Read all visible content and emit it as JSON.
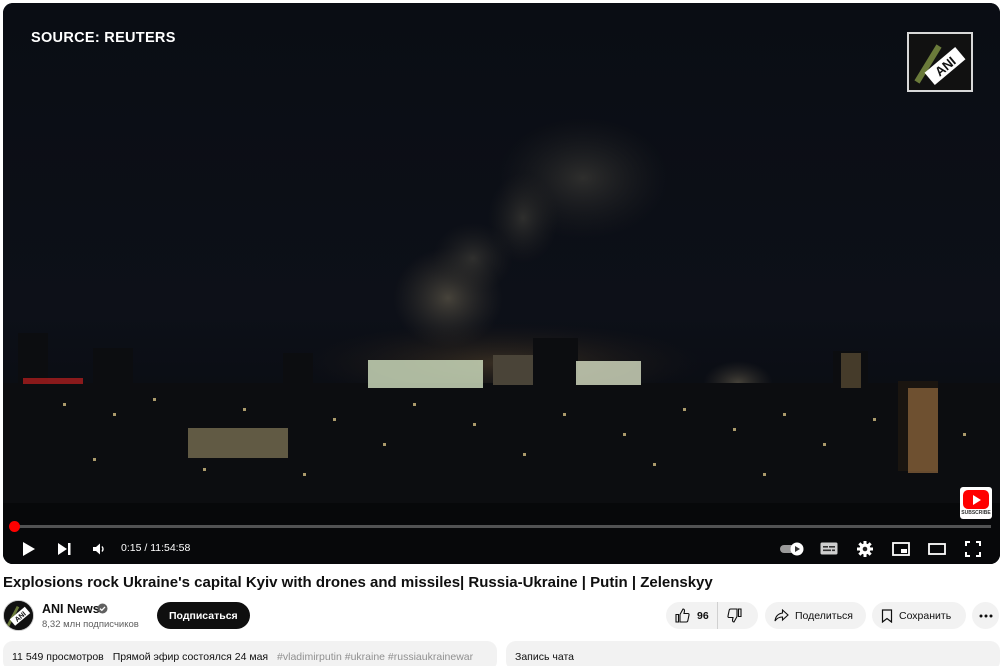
{
  "player": {
    "source_overlay": "SOURCE: REUTERS",
    "channel_watermark": "ANI",
    "subscribe_watermark": "SUBSCRIBE",
    "time": {
      "display": "0:15 / 11:54:58",
      "progress_fraction": 0.0004
    },
    "controls": [
      "play",
      "next",
      "volume",
      "autoplay-toggle",
      "subtitles",
      "settings",
      "miniplayer",
      "theater-mode",
      "fullscreen"
    ]
  },
  "video": {
    "title": "Explosions rock Ukraine's capital Kyiv with drones and missiles| Russia-Ukraine | Putin | Zelenskyy"
  },
  "owner": {
    "avatar_text": "ANI",
    "channel_name": "ANI News",
    "subscribers": "8,32 млн подписчиков",
    "subscribe_label": "Подписаться"
  },
  "actions": {
    "like_count": "96",
    "share_label": "Поделиться",
    "save_label": "Сохранить"
  },
  "description": {
    "views": "11 549 просмотров",
    "premiere": "Прямой эфир состоялся 24 мая",
    "tags": "#vladimirputin #ukraine #russiaukrainewar"
  },
  "chat": {
    "label": "Запись чата"
  },
  "colors": {
    "accent_red": "#ff0000",
    "pill_bg": "#f2f2f2",
    "subscribe_bg": "#0f0f0f"
  }
}
